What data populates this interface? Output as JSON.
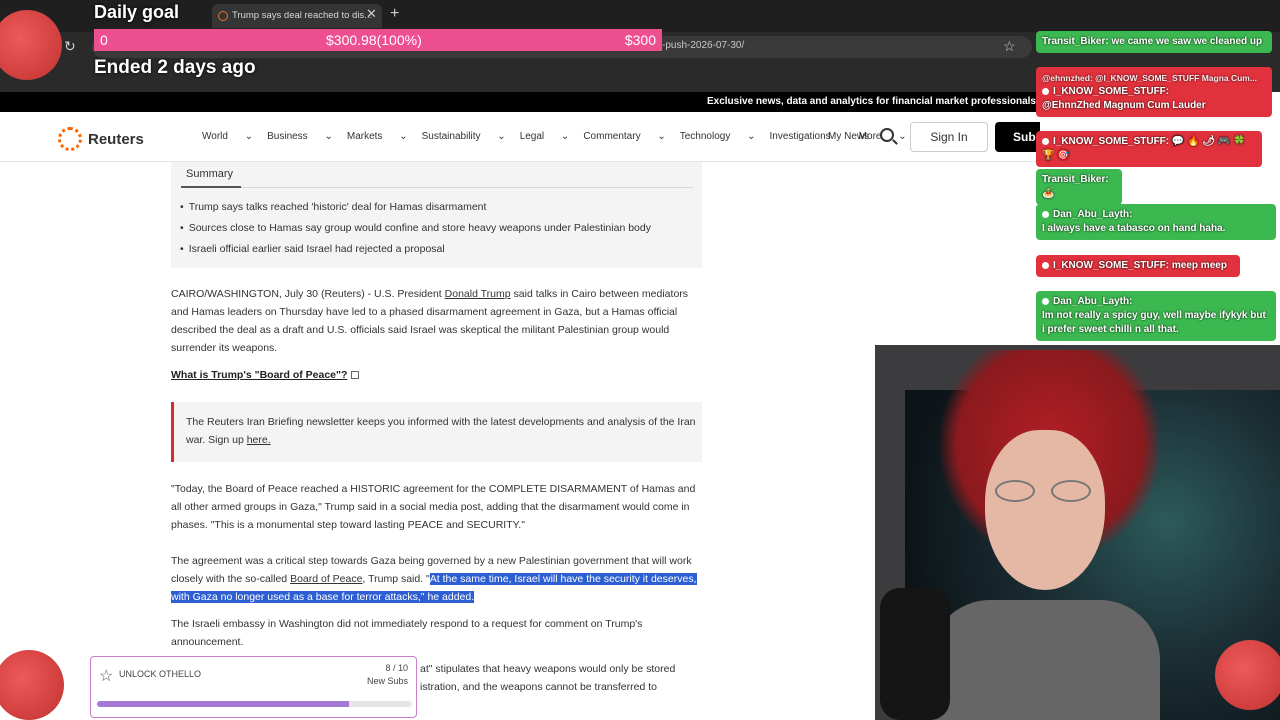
{
  "browser": {
    "tab_title": "Trump says deal reached to dis...",
    "url_tail": "-push-2026-07-30/"
  },
  "goal": {
    "title": "Daily goal",
    "start": "0",
    "current": "$300.98(100%)",
    "target": "$300",
    "progress": 1.0,
    "status": "Ended 2 days ago"
  },
  "ticker": "Exclusive news, data and analytics for financial market professionals",
  "nav": {
    "logo": "Reuters",
    "items": [
      "World",
      "Business",
      "Markets",
      "Sustainability",
      "Legal",
      "Commentary",
      "Technology",
      "Investigations",
      "More"
    ],
    "my_news": "My News",
    "sign_in": "Sign In",
    "subscribe": "Subscribe"
  },
  "article": {
    "summary_title": "Summary",
    "summary": [
      "Trump says talks reached 'historic' deal for Hamas disarmament",
      "Sources close to Hamas say group would confine and store heavy weapons under Palestinian body",
      "Israeli official earlier said Israel had rejected a proposal"
    ],
    "p1_before": "CAIRO/WASHINGTON, July 30 (Reuters) - U.S. President ",
    "p1_link": "Donald Trump",
    "p1_after": " said talks in Cairo between mediators and Hamas leaders on Thursday have led to a phased disarmament agreement in Gaza, but a Hamas official described the deal as a draft and U.S. officials said Israel was skeptical the militant Palestinian group would surrender its weapons.",
    "related": "What is Trump's \"Board of Peace\"?",
    "newsletter_text": "The Reuters Iran Briefing newsletter keeps you informed with the latest developments and analysis of the Iran war. Sign up ",
    "newsletter_link": "here.",
    "p2": "\"Today, the Board of Peace reached a HISTORIC agreement for the COMPLETE DISARMAMENT of Hamas and all other armed groups in Gaza,\" Trump said in a social media post, adding that the disarmament would come in phases. \"This is a monumental step toward lasting PEACE and SECURITY.\"",
    "p3_before": "The agreement was a critical step towards Gaza being governed by a new Palestinian government that will work closely with the so-called ",
    "p3_link": "Board of Peace",
    "p3_mid": ", Trump said. \"",
    "p3_highlight": "At the same time, Israel will have the security it deserves, with Gaza no longer used as a base for terror attacks,\" he added.",
    "p4": "The Israeli embassy in Washington did not immediately respond to a request for comment on Trump's announcement.",
    "p5_line1": "at\" stipulates that heavy weapons would only be stored",
    "p5_line2": "istration, and the weapons cannot be transferred to"
  },
  "chat": [
    {
      "user": "Transit_Biker",
      "text": "we came we saw we cleaned up"
    },
    {
      "user": "@ehnnzhed",
      "text": "@I_KNOW_SOME_STUFF Magna Cum..."
    },
    {
      "user": "I_KNOW_SOME_STUFF",
      "text": "@EhnnZhed Magnum Cum Lauder"
    },
    {
      "user": "I_KNOW_SOME_STUFF",
      "text": "💬 🔥 🌶 🎮 🍀 🏆 🎯"
    },
    {
      "user": "Transit_Biker",
      "text": "🍝"
    },
    {
      "user": "Dan_Abu_Layth",
      "text": "I always have a tabasco on hand haha."
    },
    {
      "user": "I_KNOW_SOME_STUFF",
      "text": "meep meep"
    },
    {
      "user": "Dan_Abu_Layth",
      "text": "Im not really a spicy guy, well maybe ifykyk but i prefer sweet chilli n all that."
    }
  ],
  "unlock": {
    "label": "UNLOCK OTHELLO",
    "count": "8 / 10",
    "sub": "New Subs",
    "progress": 0.8
  },
  "colors": {
    "goal_bar": "#ec4d8e",
    "chat_green": "#3bb84f",
    "chat_red": "#e0313c",
    "highlight": "#2d5fd3",
    "reuters_orange": "#fa6400"
  }
}
